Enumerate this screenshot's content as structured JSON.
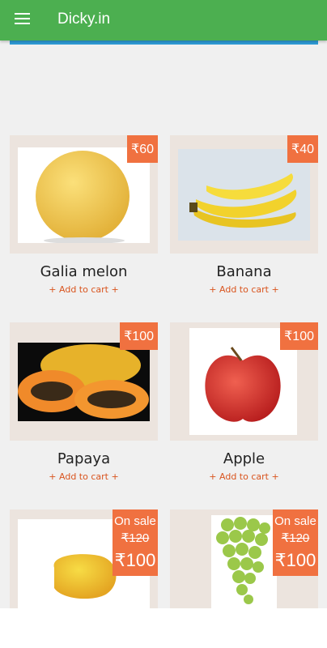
{
  "app": {
    "title": "Dicky.in"
  },
  "icons": {
    "menu": "hamburger-menu-icon"
  },
  "colors": {
    "appbar": "#4caf50",
    "price_badge": "#f07140",
    "add_to_cart": "#d9541e"
  },
  "products": [
    {
      "name": "Galia melon",
      "price": "₹60",
      "add_label": "+ Add to cart +"
    },
    {
      "name": "Banana",
      "price": "₹40",
      "add_label": "+ Add to cart +"
    },
    {
      "name": "Papaya",
      "price": "₹100",
      "add_label": "+ Add to cart +"
    },
    {
      "name": "Apple",
      "price": "₹100",
      "add_label": "+ Add to cart +"
    },
    {
      "name": "",
      "sale_label": "On sale",
      "old_price": "₹120",
      "price": "₹100"
    },
    {
      "name": "",
      "sale_label": "On sale",
      "old_price": "₹120",
      "price": "₹100"
    }
  ]
}
